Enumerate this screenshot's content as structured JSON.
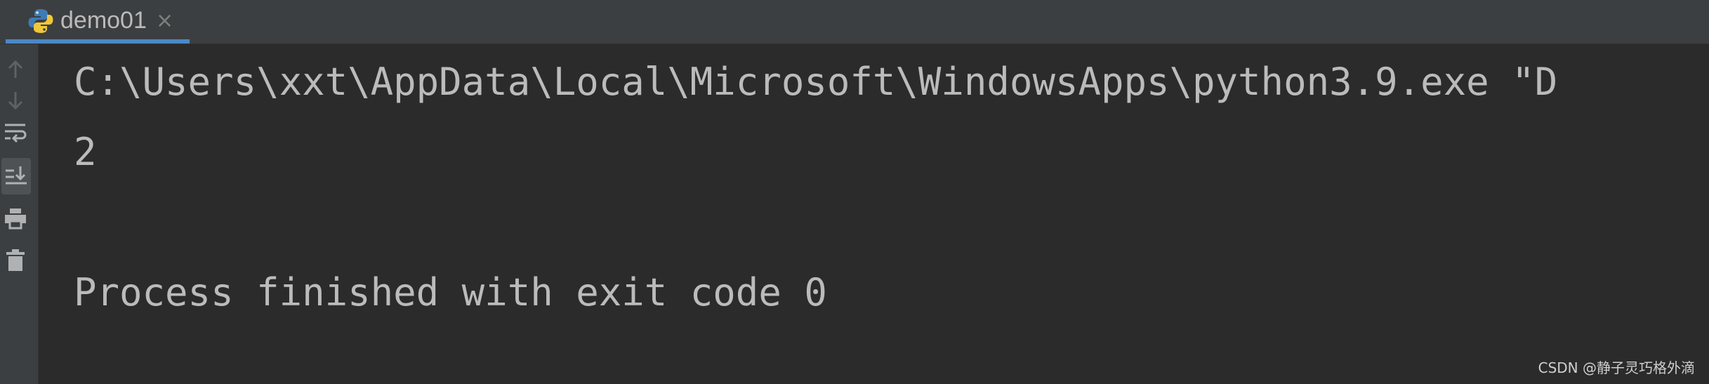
{
  "tab": {
    "title": "demo01",
    "close_glyph": "×",
    "icon": "python-icon"
  },
  "toolbar": {
    "buttons": [
      {
        "name": "up-arrow-icon"
      },
      {
        "name": "down-arrow-icon"
      },
      {
        "name": "soft-wrap-icon"
      },
      {
        "name": "scroll-to-end-icon",
        "active": true
      },
      {
        "name": "print-icon"
      },
      {
        "name": "trash-icon"
      }
    ]
  },
  "console": {
    "lines": [
      "C:\\Users\\xxt\\AppData\\Local\\Microsoft\\WindowsApps\\python3.9.exe \"D",
      "2",
      "",
      "Process finished with exit code 0"
    ]
  },
  "watermark": "CSDN @静子灵巧格外滴",
  "colors": {
    "background": "#2b2b2b",
    "panel": "#3c3f41",
    "text": "#bbbbbb",
    "tab_accent": "#4a88c7"
  }
}
